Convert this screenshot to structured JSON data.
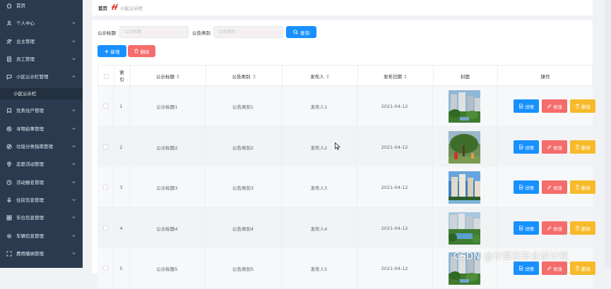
{
  "sidebar": {
    "bg_color": "#2b3a4f",
    "items": [
      {
        "label": "首页",
        "icon": "home-icon",
        "has_children": false
      },
      {
        "label": "个人中心",
        "icon": "user-icon",
        "has_children": true
      },
      {
        "label": "业主管理",
        "icon": "users-icon",
        "has_children": true
      },
      {
        "label": "员工管理",
        "icon": "document-icon",
        "has_children": true
      },
      {
        "label": "小区公示栏管理",
        "icon": "chat-icon",
        "has_children": true,
        "expanded": true,
        "children": [
          {
            "label": "小区公示栏"
          }
        ]
      },
      {
        "label": "优秀住户管理",
        "icon": "star-icon",
        "has_children": true
      },
      {
        "label": "寻物启事管理",
        "icon": "search-circle-icon",
        "has_children": true
      },
      {
        "label": "垃圾分类指南管理",
        "icon": "compass-icon",
        "has_children": true
      },
      {
        "label": "志愿活动管理",
        "icon": "location-icon",
        "has_children": true
      },
      {
        "label": "活动报名管理",
        "icon": "circle-icon",
        "has_children": true
      },
      {
        "label": "住房信息管理",
        "icon": "microphone-icon",
        "has_children": true
      },
      {
        "label": "车位信息管理",
        "icon": "grid-icon",
        "has_children": true
      },
      {
        "label": "车辆信息管理",
        "icon": "gear-icon",
        "has_children": true
      },
      {
        "label": "费用缴纳管理",
        "icon": "expand-icon",
        "has_children": true
      }
    ]
  },
  "breadcrumb": {
    "home": "首页",
    "current": "小区公示栏"
  },
  "search": {
    "title_label": "公示标题",
    "title_placeholder": "公示标题",
    "type_label": "公告类别",
    "type_placeholder": "公告类别",
    "query_button": "查询"
  },
  "actions": {
    "add": "新增",
    "batch_delete": "删除"
  },
  "table": {
    "columns": [
      "索引",
      "公示标题",
      "公告类别",
      "发布人",
      "发布日期",
      "封面",
      "操作"
    ],
    "sortable": [
      false,
      true,
      true,
      true,
      true,
      false,
      false
    ],
    "rows": [
      {
        "index": "1",
        "title": "公示标题1",
        "type": "公告类别1",
        "publisher": "发布人1",
        "date": "2021-04-12",
        "cover": "buildings-garden"
      },
      {
        "index": "2",
        "title": "公示标题2",
        "type": "公告类别2",
        "publisher": "发布人2",
        "date": "2021-04-12",
        "cover": "playground-tree"
      },
      {
        "index": "3",
        "title": "公示标题3",
        "type": "公告类别3",
        "publisher": "发布人3",
        "date": "2021-04-12",
        "cover": "towers-blue-sky"
      },
      {
        "index": "4",
        "title": "公示标题4",
        "type": "公告类别4",
        "publisher": "发布人4",
        "date": "2021-04-12",
        "cover": "buildings-pool"
      },
      {
        "index": "5",
        "title": "公示标题5",
        "type": "公告类别5",
        "publisher": "发布人5",
        "date": "2021-04-12",
        "cover": "buildings-garden"
      }
    ],
    "row_actions": {
      "detail": "详情",
      "edit": "修改",
      "delete": "删除"
    }
  },
  "watermark": "CSDN @计算机毕业设计程",
  "colors": {
    "primary": "#1890ff",
    "danger": "#f56c6c",
    "warning": "#f7ba2a"
  }
}
